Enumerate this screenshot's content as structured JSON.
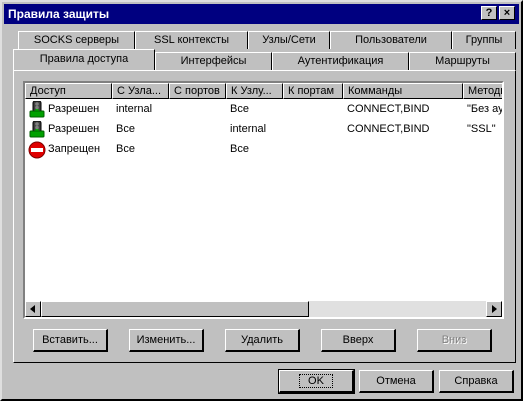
{
  "window": {
    "title": "Правила защиты",
    "help_symbol": "?",
    "close_symbol": "×"
  },
  "tabs_row1": [
    {
      "label": "SOCKS серверы"
    },
    {
      "label": "SSL контексты"
    },
    {
      "label": "Узлы/Сети"
    },
    {
      "label": "Пользователи"
    },
    {
      "label": "Группы"
    }
  ],
  "tabs_row2": [
    {
      "label": "Правила доступа",
      "active": true
    },
    {
      "label": "Интерфейсы"
    },
    {
      "label": "Аутентификация"
    },
    {
      "label": "Маршруты"
    }
  ],
  "list": {
    "columns": [
      "Доступ",
      "С Узла...",
      "С портов",
      "К Узлу...",
      "К портам",
      "Комманды",
      "Методы..."
    ],
    "rows": [
      {
        "icon": "traffic-light-icon",
        "cells": [
          "Разрешен",
          "internal",
          "",
          "Все",
          "",
          "CONNECT,BIND",
          "\"Без аут"
        ]
      },
      {
        "icon": "traffic-light-icon",
        "cells": [
          "Разрешен",
          "Все",
          "",
          "internal",
          "",
          "CONNECT,BIND",
          "\"SSL\""
        ]
      },
      {
        "icon": "no-entry-icon",
        "cells": [
          "Запрещен",
          "Все",
          "",
          "Все",
          "",
          "",
          ""
        ]
      }
    ]
  },
  "buttons": {
    "insert": "Вставить...",
    "edit": "Изменить...",
    "delete": "Удалить",
    "up": "Вверх",
    "down": "Вниз",
    "ok": "OK",
    "cancel": "Отмена",
    "help": "Справка"
  },
  "colors": {
    "title_bar": "#000080",
    "face": "#c0c0c0",
    "list_bg": "#ffffff",
    "deny_red": "#e00000",
    "allow_green": "#00c000"
  }
}
